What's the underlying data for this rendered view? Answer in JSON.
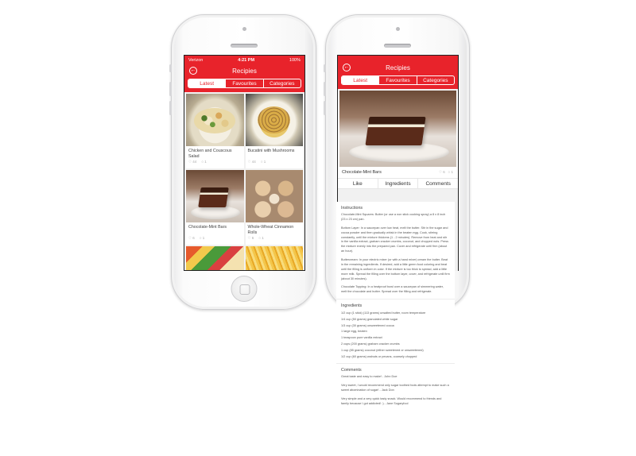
{
  "left_screen": {
    "status": {
      "carrier": "Verizon",
      "time": "4:21 PM",
      "battery": "100%"
    },
    "nav": {
      "title": "Recipies",
      "back_icon": "back-circle-icon"
    },
    "tabs": [
      {
        "label": "Latest",
        "active": true
      },
      {
        "label": "Favourites",
        "active": false
      },
      {
        "label": "Categories",
        "active": false
      }
    ],
    "cards": [
      {
        "title": "Chicken and Couscous Salad",
        "likes": "44",
        "comments": "1"
      },
      {
        "title": "Bucatini with Mushrooms",
        "likes": "44",
        "comments": "1"
      },
      {
        "title": "Chocolate-Mint Bars",
        "likes": "6",
        "comments": "1"
      },
      {
        "title": "Whole-Wheat Cinnamon Rolls",
        "likes": "6",
        "comments": "1"
      }
    ]
  },
  "right_screen": {
    "nav": {
      "title": "Recipies"
    },
    "tabs": [
      {
        "label": "Latest",
        "active": true
      },
      {
        "label": "Favourites",
        "active": false
      },
      {
        "label": "Categories",
        "active": false
      }
    ],
    "detail": {
      "title": "Chocolate-Mint Bars",
      "likes": "6",
      "comments": "1",
      "actions": {
        "like": "Like",
        "ingredients": "Ingredients",
        "comments": "Comments"
      }
    }
  },
  "sheet": {
    "instructions_heading": "Instructions",
    "instructions": [
      "Chocolate-Mint Squares: Butter (or use a non stick cooking spray) a 8 x 8 inch (23 x 23 cm) pan.",
      "Bottom Layer: In a saucepan over low heat, melt the butter. Stir in the sugar and cocoa powder and then gradually whisk in the beaten egg. Cook, stirring constantly, until the mixture thickens (1 - 2 minutes). Remove from heat and stir in the vanilla extract, graham cracker crumbs, coconut, and chopped nuts. Press the mixture evenly into the prepared pan. Cover and refrigerate until firm (about an hour).",
      "Buttercream: In your electric mixer (or with a hand mixer) cream the butter. Beat in the remaining ingredients. If desired, add a little green food coloring and beat until the filling is uniform in color. If the mixture is too thick to spread, add a little more milk. Spread the filling over the bottom layer, cover, and refrigerate until firm (about 30 minutes).",
      "Chocolate Topping: In a heatproof bowl over a saucepan of simmering water, melt the chocolate and butter. Spread over the filling and refrigerate."
    ],
    "ingredients_heading": "Ingredients",
    "ingredients": [
      "1/2 cup (1 stick) (113 grams) unsalted butter, room temperature",
      "1/4 cup (50 grams) granulated white sugar",
      "1/3 cup (30 grams) unsweetened cocoa",
      "1 large egg, beaten",
      "1 teaspoon pure vanilla extract",
      "2 cups (200 grams) graham cracker crumbs",
      "1 cup (85 grams) coconut (either sweetened or unsweetened)",
      "1/2 cup (60 grams) walnuts or pecans, coarsely chopped"
    ],
    "comments_heading": "Comments",
    "comments": [
      "Great taste and easy to make! - John Doe",
      "Very sweet, I would recommend only sugar toothed fools attempt to make such a sweet abomination of sugar! - Jack Don",
      "Very simple and a very quick tasty snack. Would recommend to friends and family because I got addicted! :) - Jane Sugaryfool"
    ]
  }
}
